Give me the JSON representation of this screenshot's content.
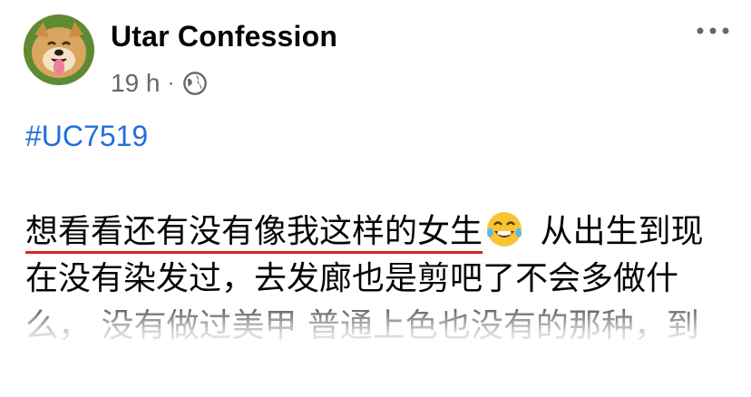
{
  "post": {
    "page_name": "Utar Confession",
    "timestamp": "19 h",
    "separator": "·",
    "privacy_icon": "globe-icon",
    "hashtag": "#UC7519",
    "text_underlined": "想看看还有没有像我这样的女生",
    "emoji": "face-with-tears-of-joy",
    "text_rest": " 从出生到现在没有染发过，去发廊也是剪吧了不会多做什么， 没有做过美甲 普通上色也没有的那种，到"
  },
  "colors": {
    "link": "#216fdb",
    "underline": "#e02020",
    "meta": "#65676b"
  }
}
